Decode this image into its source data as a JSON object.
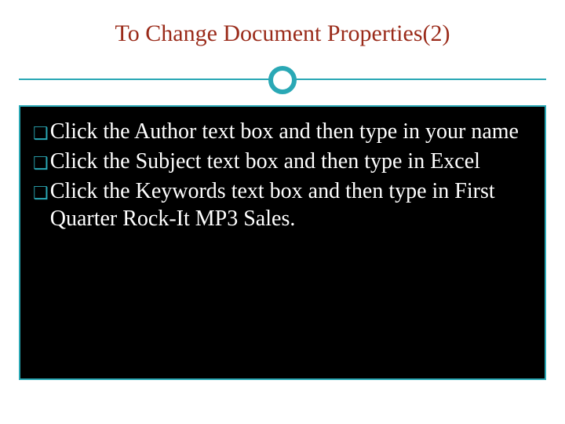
{
  "title": "To Change Document Properties(2)",
  "bullets": [
    {
      "text": "Click the Author text box and then type in your name"
    },
    {
      "text": "Click the Subject text box and then type in Excel"
    },
    {
      "text": "Click the Keywords text box and then type in First Quarter Rock-It MP3 Sales."
    }
  ],
  "colors": {
    "accent": "#2aa8b5",
    "title": "#9a2b1a",
    "content_bg": "#000000",
    "content_fg": "#ffffff"
  }
}
